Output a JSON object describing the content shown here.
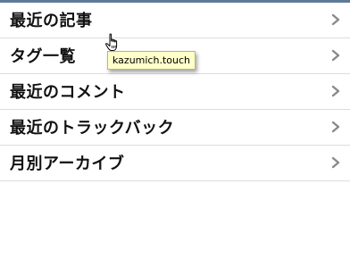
{
  "menu": {
    "items": [
      {
        "label": "最近の記事",
        "icon": "chevron-right-icon"
      },
      {
        "label": "タグ一覧",
        "icon": "chevron-right-icon"
      },
      {
        "label": "最近のコメント",
        "icon": "chevron-right-icon"
      },
      {
        "label": "最近のトラックバック",
        "icon": "chevron-right-icon"
      },
      {
        "label": "月別アーカイブ",
        "icon": "chevron-right-icon"
      }
    ]
  },
  "tooltip": {
    "text": "kazumich.touch"
  },
  "cursor": {
    "icon": "hand-pointer-icon"
  },
  "colors": {
    "topbar": "#5f7a98",
    "tooltip_bg": "#ffffc9",
    "divider": "#dcdcdc",
    "chevron": "#8a8a8a"
  }
}
